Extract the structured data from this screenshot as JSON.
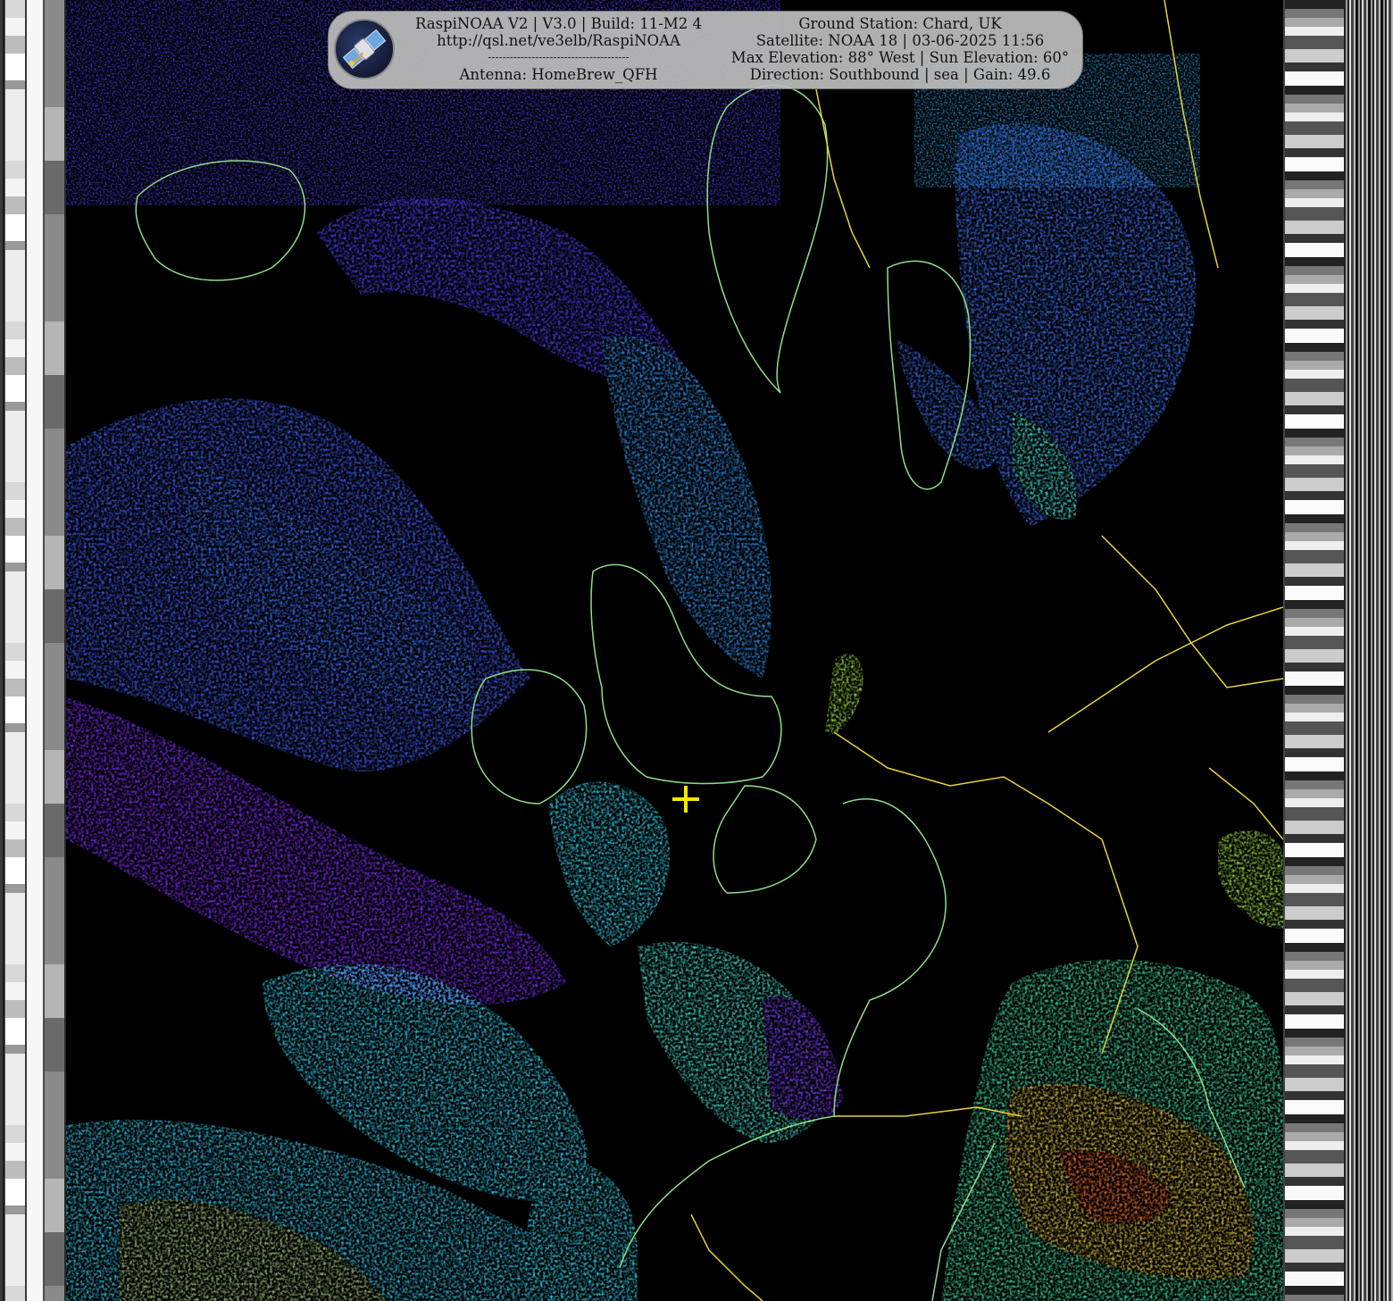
{
  "info_box": {
    "left_lines": [
      "RaspiNOAA V2 | V3.0 | Build: 11-M2 4",
      "http://qsl.net/ve3elb/RaspiNOAA",
      "---------------------------------------",
      "Antenna: HomeBrew_QFH"
    ],
    "right_lines": [
      "Ground Station: Chard, UK",
      "Satellite: NOAA 18 | 03-06-2025 11:56",
      "Max Elevation: 88° West | Sun Elevation: 60°",
      "Direction: Southbound | sea | Gain: 49.6"
    ]
  },
  "logo": {
    "icon": "satellite-icon"
  },
  "marker": {
    "icon": "crosshair-icon",
    "color": "#ffe600"
  },
  "colors": {
    "coastline": "#8fe08a",
    "border": "#e8d43a",
    "cloud_low": "#7a2cf0",
    "cloud_mid": "#3c5cf5",
    "cloud_cyan": "#30d8e8",
    "cloud_green": "#48e070",
    "cloud_warm": "#f0a020",
    "cloud_hot": "#e83020"
  }
}
